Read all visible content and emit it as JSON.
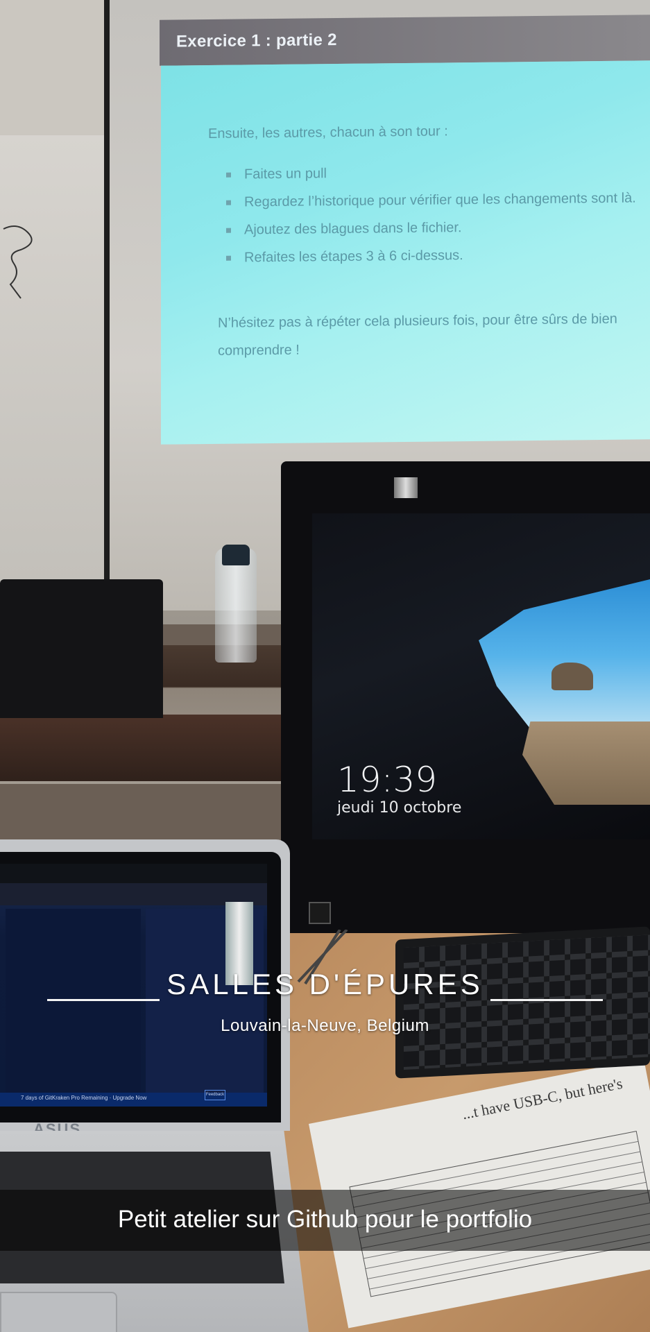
{
  "slide": {
    "title": "Exercice 1 : partie 2",
    "intro": "Ensuite, les autres, chacun à son tour :",
    "items": [
      "Faites un pull",
      "Regardez l’historique pour vérifier que les changements sont là.",
      "Ajoutez des blagues dans le fichier.",
      "Refaites les étapes 3 à 6 ci-dessus."
    ],
    "outro": "N’hésitez pas à répéter cela plusieurs fois, pour être sûrs de bien comprendre !"
  },
  "lockscreen": {
    "time": "19:39",
    "date": "jeudi 10 octobre"
  },
  "laptop": {
    "brand": "ASUS",
    "status_text": "7 days of GitKraken Pro Remaining · Upgrade Now",
    "feedback_label": "Feedback"
  },
  "paper": {
    "text": "...t have USB-C, but here's"
  },
  "geofilter": {
    "title": "SALLES D'ÉPURES",
    "location": "Louvain-la-Neuve, Belgium"
  },
  "caption": {
    "text": "Petit atelier sur Github pour le portfolio"
  },
  "colors": {
    "slide_bg": "#8fe8ec",
    "slide_header": "#7a777d",
    "slide_text": "#5b9aa7",
    "caption_bg": "rgba(0,0,0,0.55)"
  }
}
